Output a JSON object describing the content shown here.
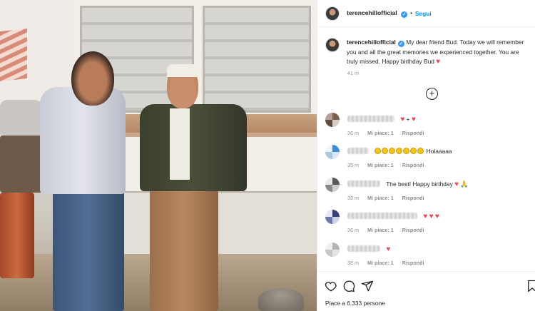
{
  "post": {
    "username": "terencehillofficial",
    "follow_label": "Segui",
    "dot": "•",
    "caption_text": "My dear friend Bud. Today we will remember you and all the great memories we experienced together. You are truly missed. Happy birthday Bud",
    "caption_time": "41 m",
    "likes_text": "Piace a 6.333 persone",
    "verified_mark": "✓"
  },
  "comments": [
    {
      "text_suffix": "+",
      "time": "36 m",
      "likes": "Mi piace: 1",
      "reply": "Rispondi"
    },
    {
      "text_suffix": "Holaaaaa",
      "time": "35 m",
      "likes": "Mi piace: 1",
      "reply": "Rispondi"
    },
    {
      "text_suffix": "The best! Happy birthday",
      "time": "33 m",
      "likes": "Mi piace: 1",
      "reply": "Rispondi"
    },
    {
      "text_suffix": "",
      "time": "36 m",
      "likes": "Mi piace: 1",
      "reply": "Rispondi"
    },
    {
      "text_suffix": "",
      "time": "38 m",
      "likes": "Mi piace: 1",
      "reply": "Rispondi"
    }
  ],
  "icons": {
    "heart": "♥",
    "plus": "+",
    "pray": "🙏"
  },
  "colors": {
    "accent": "#0095f6",
    "heart": "#ed4956",
    "verified": "#3897f0"
  }
}
